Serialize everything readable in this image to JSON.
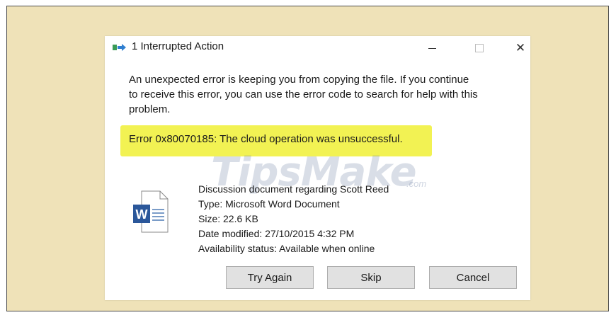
{
  "window": {
    "title": "1 Interrupted Action",
    "close_glyph": "✕"
  },
  "message": {
    "line1": "An unexpected error is keeping you from copying the file. If you continue",
    "line2": "to receive this error, you can use the error code to search for help with this",
    "line3": "problem.",
    "error": "Error 0x80070185: The cloud operation was unsuccessful."
  },
  "watermark": {
    "text": "TipsMake",
    "suffix": ".com"
  },
  "file": {
    "icon": "word-document-icon",
    "icon_letter": "W",
    "name": "Discussion document regarding Scott Reed",
    "type": "Type: Microsoft Word Document",
    "size": "Size: 22.6 KB",
    "date_modified": "Date modified: 27/10/2015 4:32 PM",
    "availability": "Availability status: Available when online"
  },
  "buttons": {
    "try_again": "Try Again",
    "skip": "Skip",
    "cancel": "Cancel"
  },
  "colors": {
    "background": "#efe2b8",
    "highlight": "#f2f253",
    "word_blue": "#2b579a"
  }
}
